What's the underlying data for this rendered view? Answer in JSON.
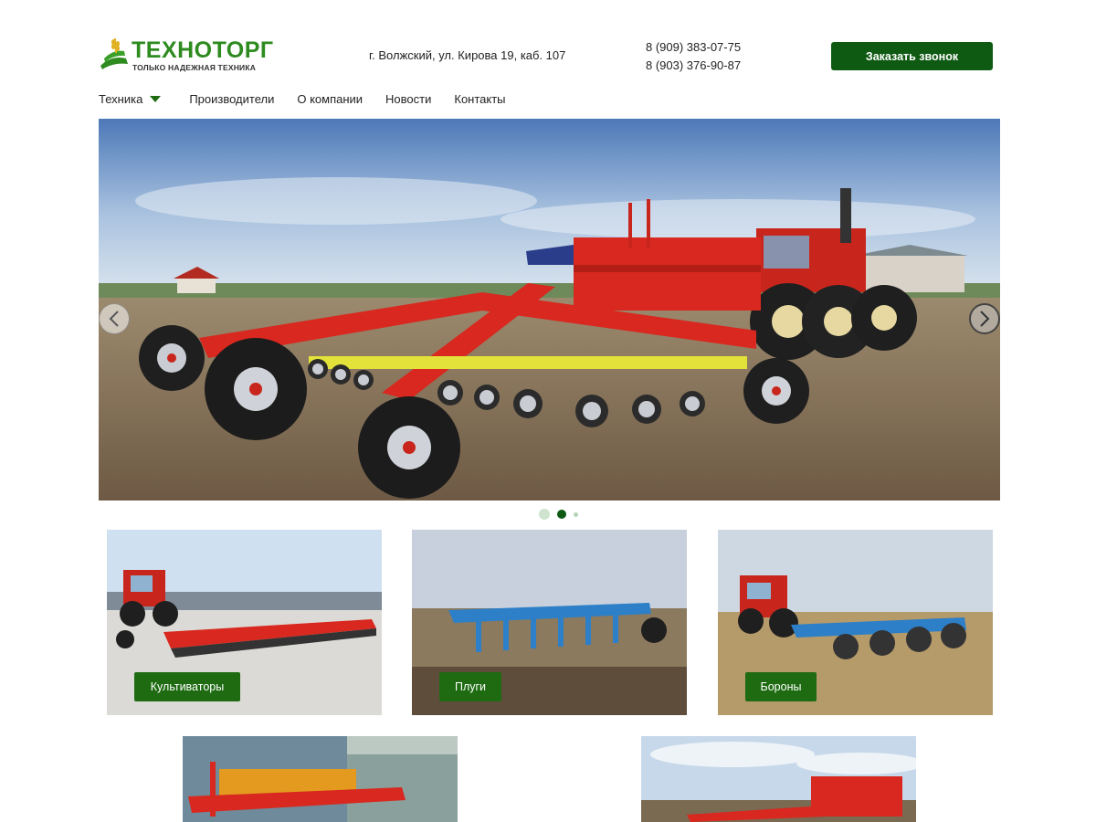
{
  "header": {
    "logo_title": "ТЕХНОТОРГ",
    "logo_subtitle": "ТОЛЬКО НАДЕЖНАЯ ТЕХНИКА",
    "address": "г. Волжский, ул. Кирова 19, каб. 107",
    "phones": [
      "8 (909) 383-07-75",
      "8 (903) 376-90-87"
    ],
    "call_button_label": "Заказать звонок"
  },
  "nav": {
    "items": [
      {
        "label": "Техника",
        "has_dropdown": true
      },
      {
        "label": "Производители"
      },
      {
        "label": "О компании"
      },
      {
        "label": "Новости"
      },
      {
        "label": "Контакты"
      }
    ]
  },
  "slider": {
    "slide_count": 3,
    "active_slide": 2
  },
  "categories": [
    {
      "label": "Культиваторы"
    },
    {
      "label": "Плуги"
    },
    {
      "label": "Бороны"
    },
    {
      "label": ""
    },
    {
      "label": ""
    }
  ],
  "colors": {
    "brand_green": "#0f5a13",
    "logo_green": "#2e8b1f",
    "machine_red": "#d8281f",
    "machine_blue": "#2d7fc7"
  }
}
